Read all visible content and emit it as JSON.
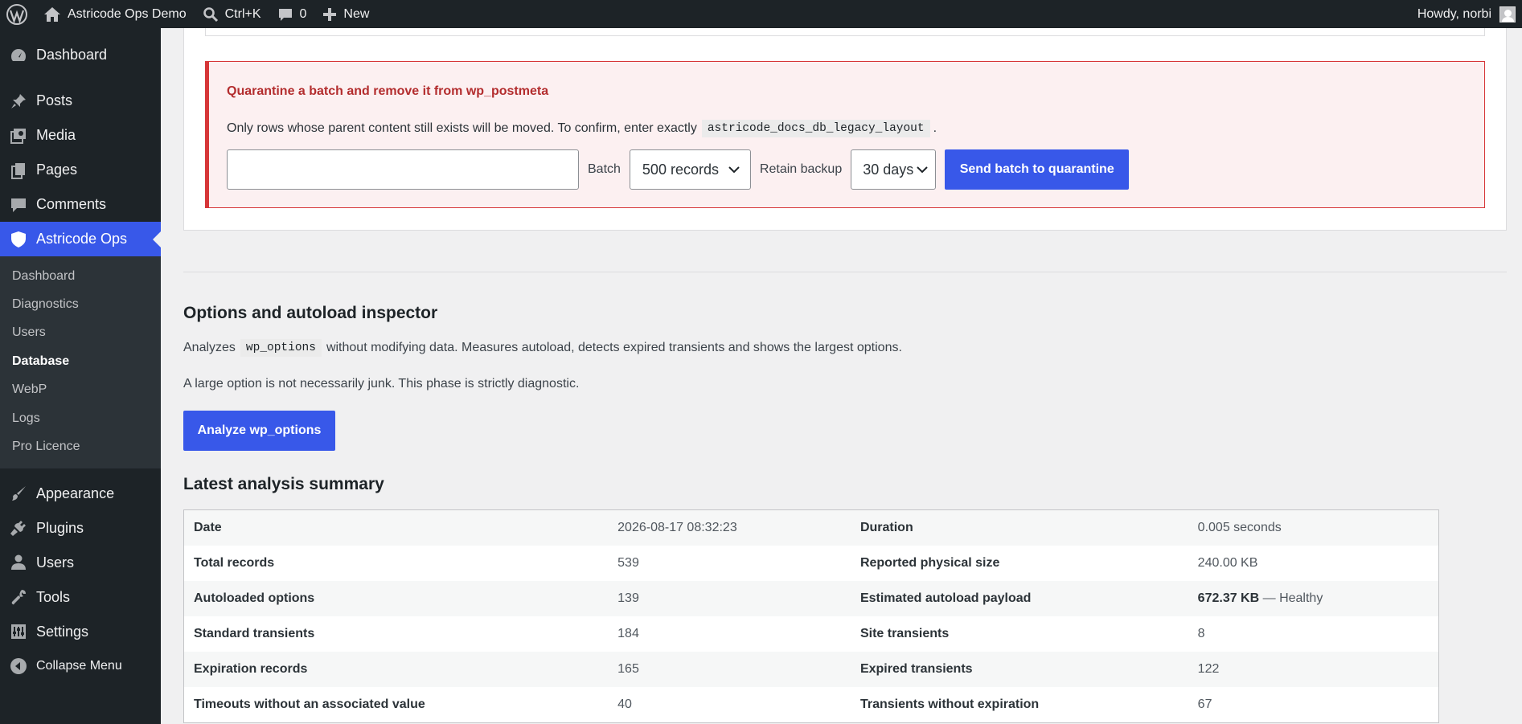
{
  "adminbar": {
    "site_name": "Astricode Ops Demo",
    "search_shortcut": "Ctrl+K",
    "comments_count": "0",
    "new_label": "New",
    "greeting": "Howdy, norbi"
  },
  "sidebar": {
    "items_top": [
      {
        "label": "Dashboard",
        "icon": "dashboard-icon"
      }
    ],
    "items_main": [
      {
        "label": "Posts",
        "icon": "pin-icon"
      },
      {
        "label": "Media",
        "icon": "media-icon"
      },
      {
        "label": "Pages",
        "icon": "pages-icon"
      },
      {
        "label": "Comments",
        "icon": "comment-icon"
      },
      {
        "label": "Astricode Ops",
        "icon": "shield-icon"
      }
    ],
    "submenu": [
      "Dashboard",
      "Diagnostics",
      "Users",
      "Database",
      "WebP",
      "Logs",
      "Pro Licence"
    ],
    "items_bottom": [
      {
        "label": "Appearance",
        "icon": "brush-icon"
      },
      {
        "label": "Plugins",
        "icon": "plug-icon"
      },
      {
        "label": "Users",
        "icon": "user-icon"
      },
      {
        "label": "Tools",
        "icon": "wrench-icon"
      },
      {
        "label": "Settings",
        "icon": "settings-icon"
      }
    ],
    "collapse_label": "Collapse Menu"
  },
  "quarantine": {
    "title": "Quarantine a batch and remove it from wp_postmeta",
    "description_prefix": "Only rows whose parent content still exists will be moved. To confirm, enter exactly",
    "confirm_code": "astricode_docs_db_legacy_layout",
    "description_suffix": ".",
    "confirm_input_value": "",
    "batch_label": "Batch",
    "batch_value": "500 records",
    "retain_label": "Retain backup",
    "retain_value": "30 days",
    "submit_label": "Send batch to quarantine"
  },
  "inspector": {
    "title": "Options and autoload inspector",
    "desc_prefix": "Analyzes",
    "desc_code": "wp_options",
    "desc_suffix": "without modifying data. Measures autoload, detects expired transients and shows the largest options.",
    "note": "A large option is not necessarily junk. This phase is strictly diagnostic.",
    "analyze_label": "Analyze wp_options"
  },
  "summary": {
    "title": "Latest analysis summary",
    "rows": [
      {
        "k1": "Date",
        "v1": "2026-08-17 08:32:23",
        "k2": "Duration",
        "v2": "0.005 seconds"
      },
      {
        "k1": "Total records",
        "v1": "539",
        "k2": "Reported physical size",
        "v2": "240.00 KB"
      },
      {
        "k1": "Autoloaded options",
        "v1": "139",
        "k2": "Estimated autoload payload",
        "v2": "672.37 KB",
        "v2_note": "— Healthy"
      },
      {
        "k1": "Standard transients",
        "v1": "184",
        "k2": "Site transients",
        "v2": "8"
      },
      {
        "k1": "Expiration records",
        "v1": "165",
        "k2": "Expired transients",
        "v2": "122"
      },
      {
        "k1": "Timeouts without an associated value",
        "v1": "40",
        "k2": "Transients without expiration",
        "v2": "67"
      }
    ]
  }
}
